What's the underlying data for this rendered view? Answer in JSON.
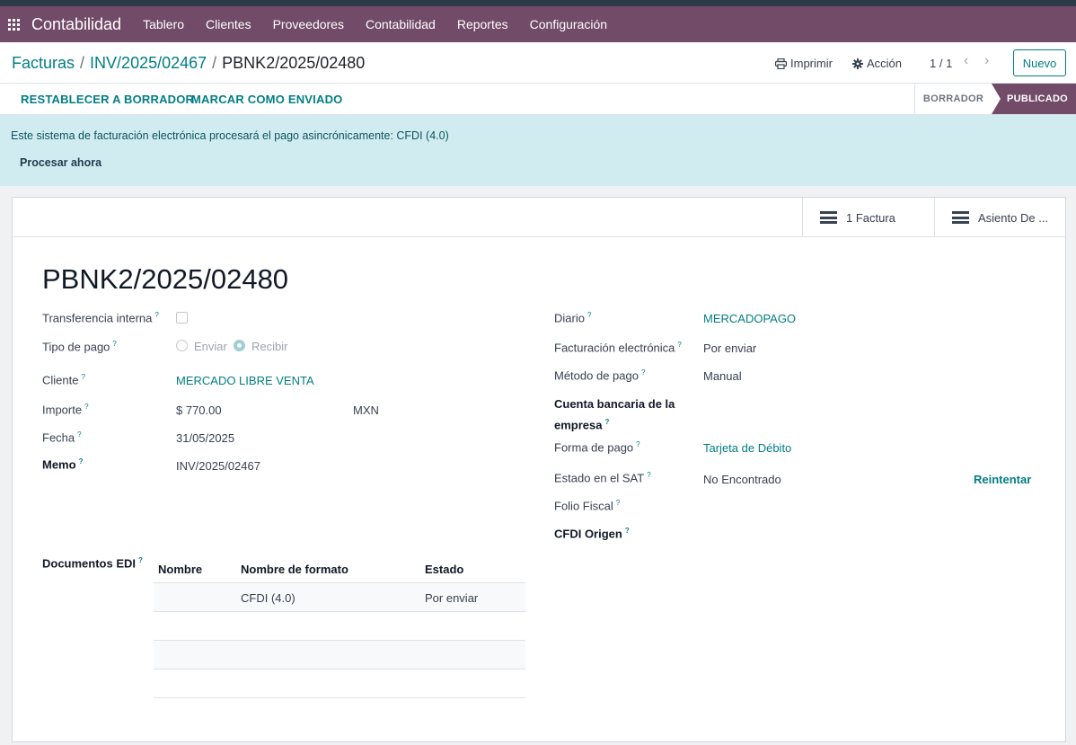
{
  "navbar": {
    "app_name": "Contabilidad",
    "menu": [
      "Tablero",
      "Clientes",
      "Proveedores",
      "Contabilidad",
      "Reportes",
      "Configuración"
    ]
  },
  "breadcrumb": {
    "items": [
      "Facturas",
      "INV/2025/02467"
    ],
    "current": "PBNK2/2025/02480"
  },
  "controls": {
    "print": "Imprimir",
    "action": "Acción",
    "pager": "1 / 1",
    "new": "Nuevo"
  },
  "statusbar": {
    "reset": "RESTABLECER A BORRADOR",
    "mark_sent": "MARCAR COMO ENVIADO",
    "stages": [
      "BORRADOR",
      "PUBLICADO"
    ],
    "active_stage": "PUBLICADO"
  },
  "alert": {
    "text": "Este sistema de facturación electrónica procesará el pago asincrónicamente: CFDI (4.0)",
    "link": "Procesar ahora"
  },
  "smart_buttons": [
    "1 Factura",
    "Asiento De ..."
  ],
  "form": {
    "title": "PBNK2/2025/02480",
    "left": {
      "internal_transfer": {
        "label": "Transferencia interna",
        "checked": false
      },
      "payment_type": {
        "label": "Tipo de pago",
        "options": [
          "Enviar",
          "Recibir"
        ],
        "selected": "Recibir"
      },
      "customer": {
        "label": "Cliente",
        "value": "MERCADO LIBRE VENTA"
      },
      "amount": {
        "label": "Importe",
        "value": "$ 770.00",
        "currency": "MXN"
      },
      "date": {
        "label": "Fecha",
        "value": "31/05/2025"
      },
      "memo": {
        "label": "Memo",
        "value": "INV/2025/02467"
      }
    },
    "right": {
      "journal": {
        "label": "Diario",
        "value": "MERCADOPAGO"
      },
      "einvoice": {
        "label": "Facturación electrónica",
        "value": "Por enviar"
      },
      "payment_method": {
        "label": "Método de pago",
        "value": "Manual"
      },
      "bank_account": {
        "label_line1": "Cuenta bancaria de la",
        "label_line2": "empresa",
        "value": ""
      },
      "payment_form": {
        "label": "Forma de pago",
        "value": "Tarjeta de Débito"
      },
      "sat_status": {
        "label": "Estado en el SAT",
        "value": "No Encontrado",
        "retry": "Reintentar"
      },
      "fiscal_folio": {
        "label": "Folio Fiscal",
        "value": ""
      },
      "cfdi_origin": {
        "label": "CFDI Origen",
        "value": ""
      }
    },
    "edi": {
      "label": "Documentos EDI",
      "headers": [
        "Nombre",
        "Nombre de formato",
        "Estado"
      ],
      "rows": [
        {
          "name": "",
          "format": "CFDI (4.0)",
          "state": "Por enviar"
        }
      ]
    }
  },
  "colors": {
    "brand": "#714b67",
    "link": "#017e84",
    "alert_bg": "#d1ecf1"
  }
}
